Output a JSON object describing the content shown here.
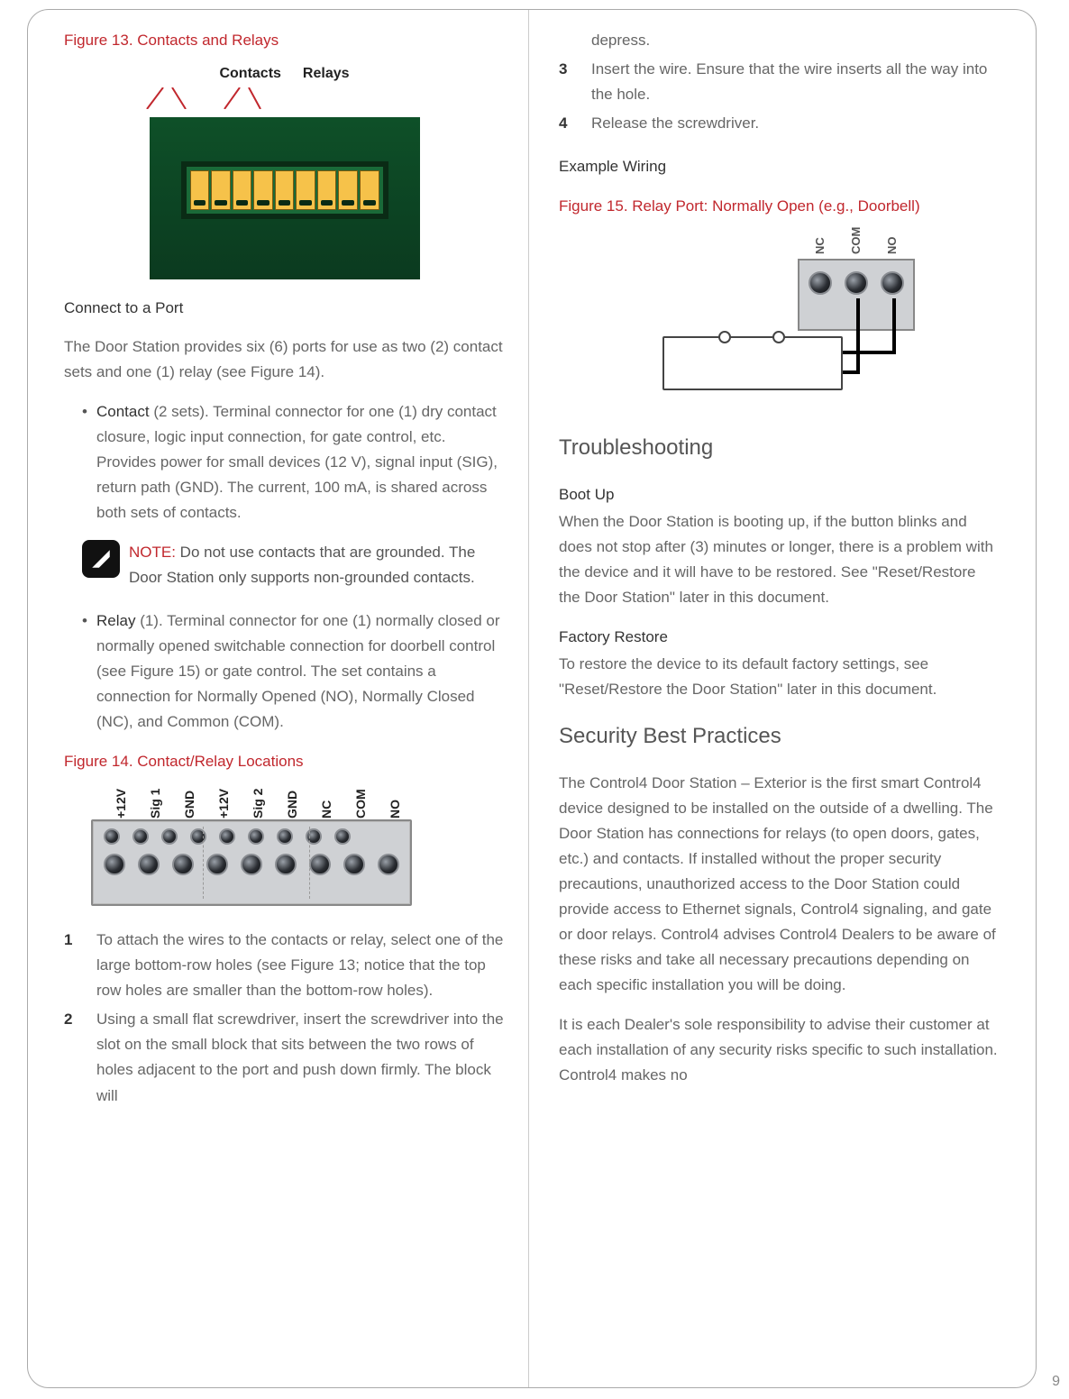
{
  "page_number": "9",
  "left": {
    "fig13_caption": "Figure 13. Contacts and Relays",
    "fig13_label_contacts": "Contacts",
    "fig13_label_relays": "Relays",
    "connect_heading": "Connect to a Port",
    "connect_para": "The Door Station provides six (6) ports for use as two (2) contact sets and one (1) relay (see Figure 14).",
    "contact_term": "Contact",
    "contact_text": " (2 sets). Terminal connector for one (1) dry contact closure, logic input connection, for gate control, etc. Provides power for small devices (12 V), signal input (SIG), return path (GND). The current, 100 mA, is shared across both sets of contacts.",
    "note_label": "NOTE:",
    "note_text": " Do not use contacts that are grounded. The Door Station only supports non-grounded contacts.",
    "relay_term": "Relay",
    "relay_text": " (1). Terminal connector for one (1) normally closed or normally opened switchable connection for doorbell control (see Figure 15) or gate control. The set contains a connection for Normally Opened (NO), Normally Closed (NC), and Common (COM).",
    "fig14_caption": "Figure 14. Contact/Relay Locations",
    "fig14_labels": [
      "+12V",
      "Sig 1",
      "GND",
      "+12V",
      "Sig 2",
      "GND",
      "NC",
      "COM",
      "NO"
    ],
    "step1": "To attach the wires to the contacts or relay, select one of the large bottom-row holes (see Figure 13; notice that the top row holes are smaller than the bottom-row holes).",
    "step2": "Using a small flat screwdriver, insert the screwdriver into the slot on the small block that sits between the two rows of holes adjacent to the port and push down firmly. The block will"
  },
  "right": {
    "step2_cont": "depress.",
    "step3": "Insert the wire. Ensure that the wire inserts all the way into the hole.",
    "step4": "Release the screwdriver.",
    "example_wiring": "Example Wiring",
    "fig15_caption": "Figure 15. Relay Port: Normally Open (e.g., Doorbell)",
    "fig15_labels": [
      "NC",
      "COM",
      "NO"
    ],
    "troubleshooting": "Troubleshooting",
    "bootup_h": "Boot Up",
    "bootup_p": "When the Door Station is booting up, if the button blinks and does not stop after (3) minutes or longer, there is a problem with the device and it will have to be restored. See \"Reset/Restore the Door Station\" later in this document.",
    "factory_h": "Factory Restore",
    "factory_p": "To restore the device to its default factory settings, see \"Reset/Restore the Door Station\" later in this document.",
    "security_h": "Security Best Practices",
    "security_p1": "The Control4 Door Station – Exterior is the first smart Control4 device designed to be installed on the outside of a dwelling. The Door Station has connections for relays (to open doors, gates, etc.) and contacts. If installed without the proper security precautions, unauthorized access to the Door Station could provide access to Ethernet signals, Control4 signaling, and gate or door relays. Control4 advises Control4 Dealers to be aware of these risks and take all necessary precautions depending on each specific installation you will be doing.",
    "security_p2": "It is each Dealer's sole responsibility to advise their customer at each installation of any security risks specific to such installation.  Control4 makes no"
  }
}
